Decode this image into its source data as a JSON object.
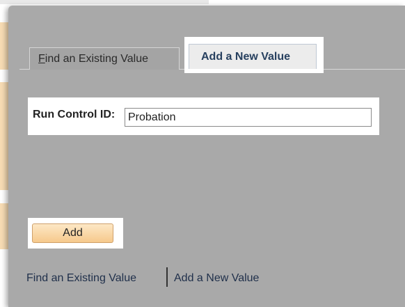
{
  "tabs": {
    "find_existing": {
      "prefix": "",
      "accesskey": "F",
      "rest": "ind an Existing Value"
    },
    "add_new": {
      "label": "Add a New Value",
      "active": true
    }
  },
  "form": {
    "run_control_label": "Run Control ID:",
    "run_control_value": "Probation"
  },
  "buttons": {
    "add_label": "Add"
  },
  "links": {
    "find_existing": "Find an Existing Value",
    "separator": "|",
    "add_new": "Add a New Value"
  },
  "colors": {
    "panel_bg": "#a9a9a9",
    "active_tab_bg": "#ececec",
    "highlight": "#ffffff",
    "button_bg": "#f6c98c",
    "link": "#1f2f4a"
  }
}
